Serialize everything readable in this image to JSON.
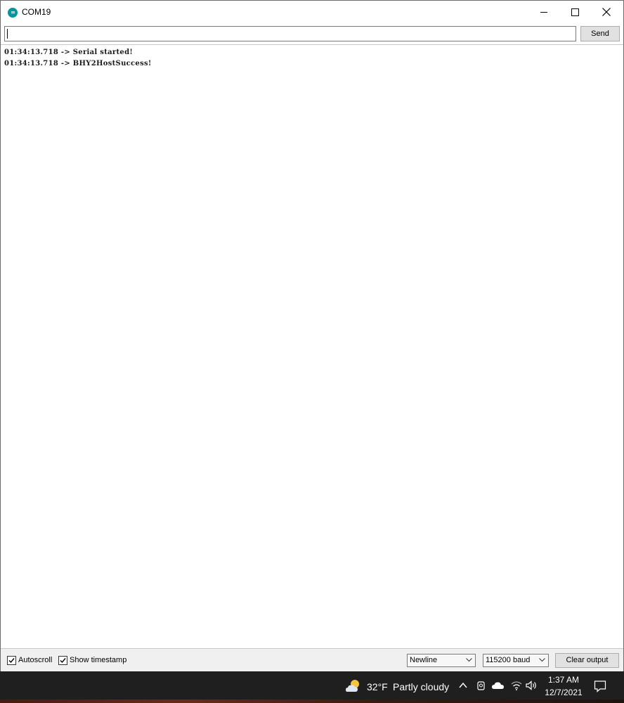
{
  "window": {
    "title": "COM19",
    "app_icon": "arduino-infinity-icon"
  },
  "send_row": {
    "input_value": "",
    "send_label": "Send"
  },
  "output": {
    "lines": [
      "01:34:13.718 -> Serial started!",
      "01:34:13.718 -> BHY2HostSuccess!"
    ]
  },
  "bottom_bar": {
    "autoscroll_label": "Autoscroll",
    "autoscroll_checked": true,
    "timestamp_label": "Show timestamp",
    "timestamp_checked": true,
    "line_ending": "Newline",
    "baud_rate": "115200 baud",
    "clear_label": "Clear output"
  },
  "taskbar": {
    "weather_temp": "32°F",
    "weather_condition": "Partly cloudy",
    "time": "1:37 AM",
    "date": "12/7/2021"
  },
  "colors": {
    "accent": "#00979c",
    "taskbar": "#1f1f1f"
  }
}
